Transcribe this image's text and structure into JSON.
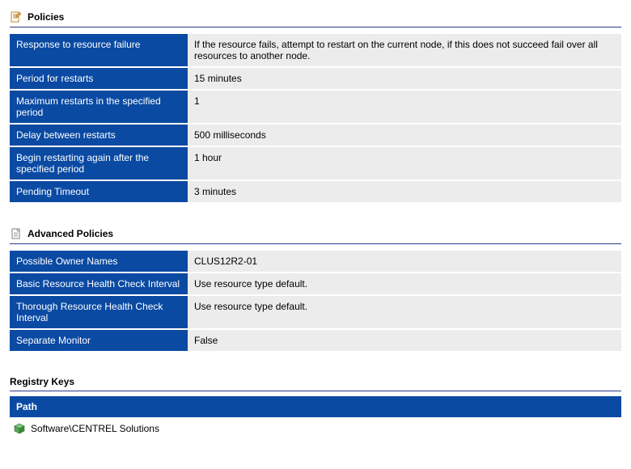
{
  "sections": {
    "policies": {
      "title": "Policies",
      "rows": [
        {
          "label": "Response to resource failure",
          "value": "If the resource fails, attempt to restart on the current node, if this does not succeed fail over all resources to another node."
        },
        {
          "label": "Period for restarts",
          "value": "15 minutes"
        },
        {
          "label": "Maximum restarts in the specified period",
          "value": "1"
        },
        {
          "label": "Delay between restarts",
          "value": "500 milliseconds"
        },
        {
          "label": "Begin restarting again after the specified period",
          "value": "1 hour"
        },
        {
          "label": "Pending Timeout",
          "value": "3 minutes"
        }
      ]
    },
    "advanced": {
      "title": "Advanced Policies",
      "rows": [
        {
          "label": "Possible Owner Names",
          "value": "CLUS12R2-01"
        },
        {
          "label": "Basic Resource Health Check Interval",
          "value": "Use resource type default."
        },
        {
          "label": "Thorough Resource Health Check Interval",
          "value": "Use resource type default."
        },
        {
          "label": "Separate Monitor",
          "value": "False"
        }
      ]
    },
    "registry": {
      "title": "Registry Keys",
      "column_header": "Path",
      "rows": [
        {
          "value": "Software\\CENTREL Solutions"
        }
      ]
    }
  }
}
